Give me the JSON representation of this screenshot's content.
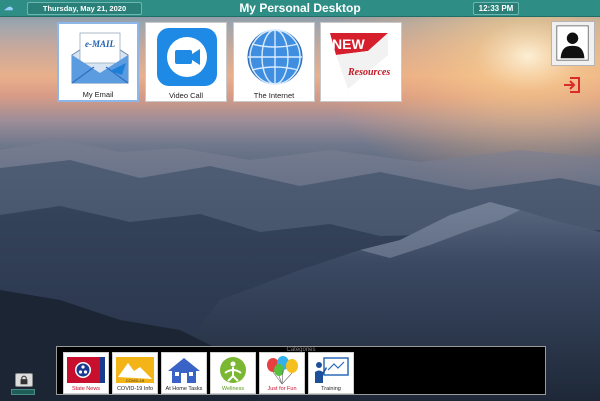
{
  "header": {
    "date": "Thursday, May 21, 2020",
    "title": "My Personal Desktop",
    "time": "12:33 PM"
  },
  "tiles": [
    {
      "label": "My Email",
      "icon": "email-envelope-icon"
    },
    {
      "label": "Video Call",
      "icon": "video-camera-icon"
    },
    {
      "label": "The Internet",
      "icon": "globe-icon"
    },
    {
      "label": "",
      "icon": "new-resources-icon",
      "art_text_top": "NEW",
      "art_text_bottom": "Resources"
    }
  ],
  "profile": {
    "icon": "user-silhouette-icon"
  },
  "logout": {
    "icon": "logout-icon",
    "color": "#d92b2b"
  },
  "categories": {
    "title": "Categories",
    "items": [
      {
        "label": "State News",
        "icon": "tennessee-flag-icon"
      },
      {
        "label": "COVID-19 Info",
        "icon": "covid-info-icon"
      },
      {
        "label": "At Home Tasks",
        "icon": "house-icon"
      },
      {
        "label": "Wellness",
        "icon": "wellness-icon"
      },
      {
        "label": "Just for Fun",
        "icon": "balloons-icon"
      },
      {
        "label": "Training",
        "icon": "training-board-icon"
      }
    ]
  },
  "colors": {
    "header": "#2e8e86",
    "accent_blue": "#1e7fd8",
    "tile_bg": "#ffffff"
  }
}
